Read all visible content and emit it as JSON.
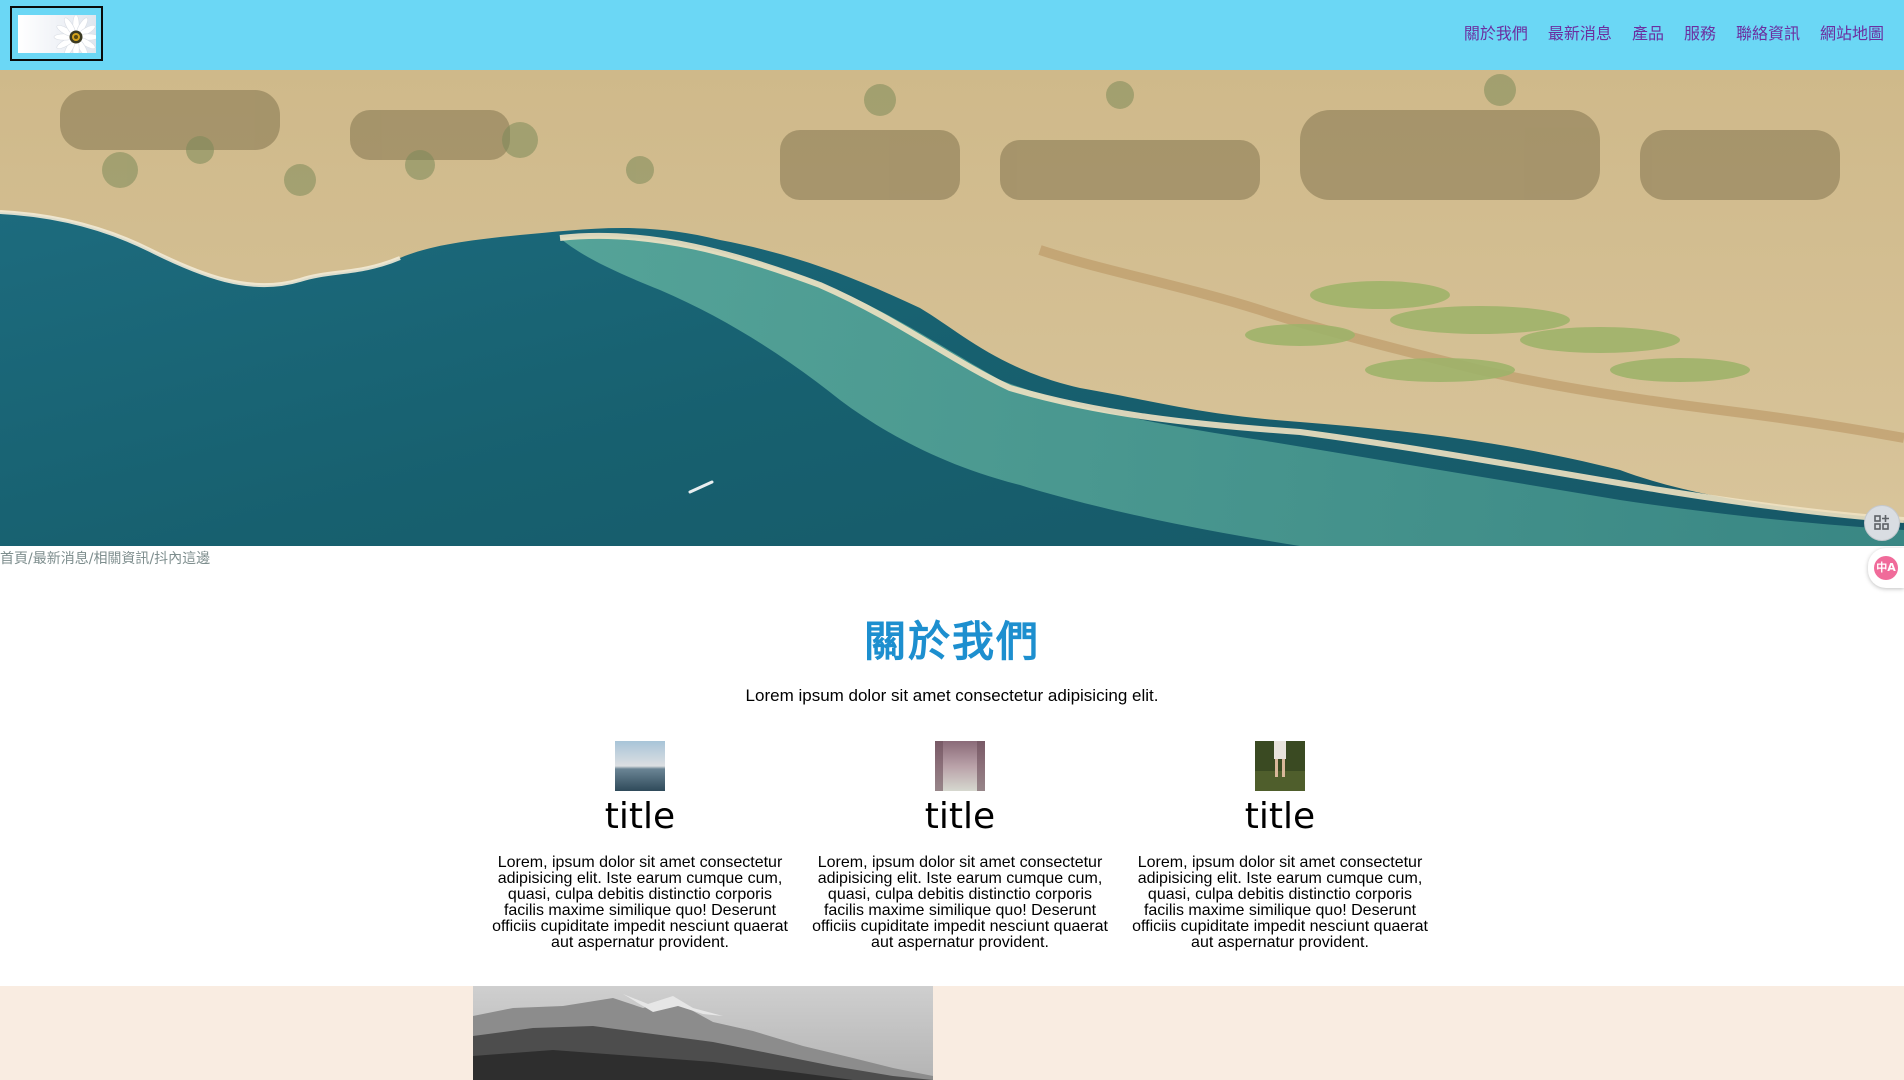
{
  "nav": {
    "items": [
      "關於我們",
      "最新消息",
      "產品",
      "服務",
      "聯絡資訊",
      "網站地圖"
    ]
  },
  "breadcrumb": {
    "items": [
      "首頁",
      "最新消息",
      "相關資訊",
      "抖內這邊"
    ],
    "separator": "/"
  },
  "about": {
    "title": "關於我們",
    "subtitle": "Lorem ipsum dolor sit amet consectetur adipisicing elit.",
    "cards": [
      {
        "title": "title",
        "text": "Lorem, ipsum dolor sit amet consectetur adipisicing elit. Iste earum cumque cum, quasi, culpa debitis distinctio corporis facilis maxime similique quo! Deserunt officiis cupiditate impedit nesciunt quaerat aut aspernatur provident."
      },
      {
        "title": "title",
        "text": "Lorem, ipsum dolor sit amet consectetur adipisicing elit. Iste earum cumque cum, quasi, culpa debitis distinctio corporis facilis maxime similique quo! Deserunt officiis cupiditate impedit nesciunt quaerat aut aspernatur provident."
      },
      {
        "title": "title",
        "text": "Lorem, ipsum dolor sit amet consectetur adipisicing elit. Iste earum cumque cum, quasi, culpa debitis distinctio corporis facilis maxime similique quo! Deserunt officiis cupiditate impedit nesciunt quaerat aut aspernatur provident."
      }
    ]
  },
  "widgets": {
    "apps_icon": "apps-icon",
    "translate_icon": "translate-icon",
    "translate_glyph": "中A"
  },
  "colors": {
    "header_bg": "#6bd7f5",
    "nav_link": "#6b2fa0",
    "title_blue": "#1d8fcf",
    "breadcrumb": "#7e8e8e",
    "bottom_bg": "#f9ece1"
  }
}
